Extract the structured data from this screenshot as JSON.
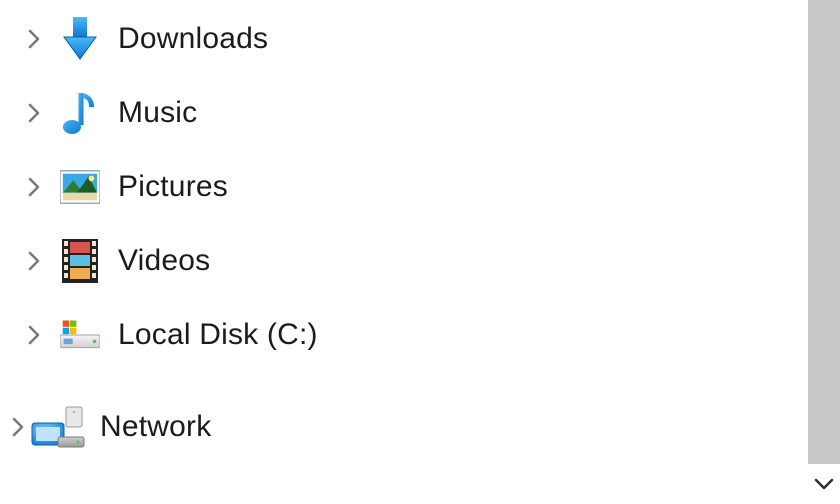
{
  "tree": {
    "items": [
      {
        "label": "Downloads",
        "icon": "downloads-icon",
        "expandable": true
      },
      {
        "label": "Music",
        "icon": "music-icon",
        "expandable": true
      },
      {
        "label": "Pictures",
        "icon": "pictures-icon",
        "expandable": true
      },
      {
        "label": "Videos",
        "icon": "videos-icon",
        "expandable": true
      },
      {
        "label": "Local Disk (C:)",
        "icon": "local-disk-icon",
        "expandable": true
      }
    ],
    "root_items": [
      {
        "label": "Network",
        "icon": "network-icon",
        "expandable": true
      }
    ]
  },
  "colors": {
    "accent_blue": "#1e98e6",
    "chevron_gray": "#7a7a7a",
    "scrollbar_track": "#c8c8c8"
  }
}
